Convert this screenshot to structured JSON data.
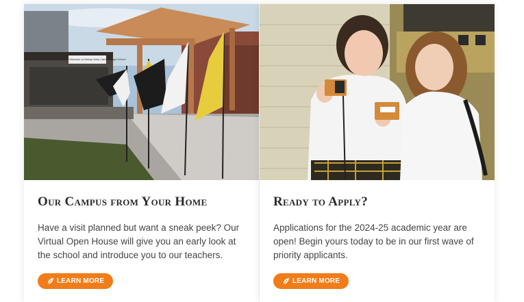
{
  "colors": {
    "accent": "#f07d19",
    "title": "#2b2b2b",
    "text": "#444444"
  },
  "cards": [
    {
      "image": "campus-entrance-photo",
      "image_sign": "Welcome to Bishop Kelly Catholic High School",
      "title": "Our Campus from Your Home",
      "text": "Have a visit planned but want a sneak peek? Our Virtual Open House will give you an early look at the school and introduce you to our teachers.",
      "button_label": "LEARN MORE",
      "button_icon": "leaf-icon"
    },
    {
      "image": "students-holding-cards-photo",
      "title": "Ready to Apply?",
      "text": "Applications for the 2024-25 academic year are open! Begin yours today to be in our first wave of priority applicants.",
      "button_label": "LEARN MORE",
      "button_icon": "leaf-icon"
    }
  ]
}
